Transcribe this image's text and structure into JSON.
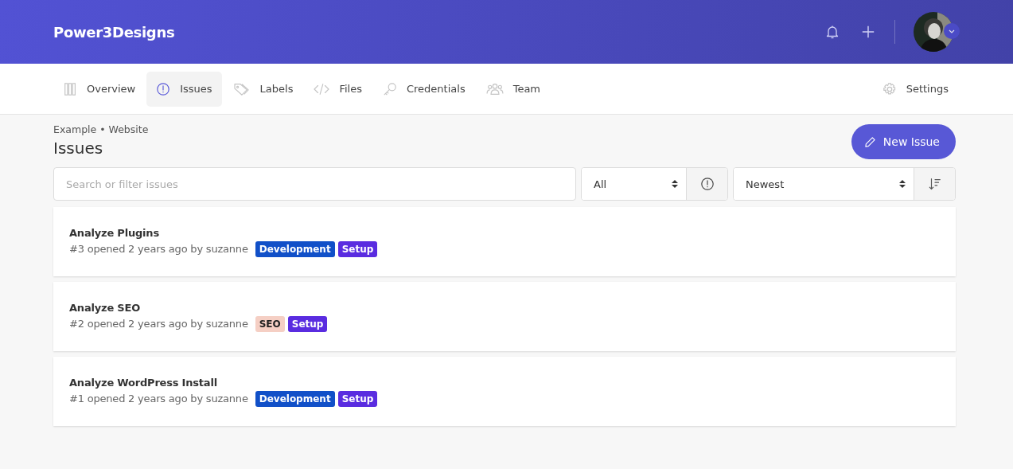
{
  "brand": "Power3Designs",
  "tabs": [
    {
      "label": "Overview",
      "kind": "overview",
      "selected": false
    },
    {
      "label": "Issues",
      "kind": "issues",
      "selected": true
    },
    {
      "label": "Labels",
      "kind": "labels",
      "selected": false
    },
    {
      "label": "Files",
      "kind": "files",
      "selected": false
    },
    {
      "label": "Credentials",
      "kind": "credentials",
      "selected": false
    },
    {
      "label": "Team",
      "kind": "team",
      "selected": false
    }
  ],
  "settings_tab": {
    "label": "Settings",
    "kind": "settings",
    "selected": false
  },
  "breadcrumb": "Example • Website",
  "page_title": "Issues",
  "new_button": "New Issue",
  "search": {
    "placeholder": "Search or filter issues"
  },
  "status_filter": "All",
  "sort": "Newest",
  "issues": [
    {
      "title": "Analyze Plugins",
      "meta": "#3 opened 2 years ago by suzanne",
      "labels": [
        {
          "text": "Development",
          "color": "#1150c8"
        },
        {
          "text": "Setup",
          "color": "#5a2ce0"
        }
      ]
    },
    {
      "title": "Analyze SEO",
      "meta": "#2 opened 2 years ago by suzanne",
      "labels": [
        {
          "text": "SEO",
          "color": "#f5cfc4"
        },
        {
          "text": "Setup",
          "color": "#5a2ce0"
        }
      ]
    },
    {
      "title": "Analyze WordPress Install",
      "meta": "#1 opened 2 years ago by suzanne",
      "labels": [
        {
          "text": "Development",
          "color": "#1150c8"
        },
        {
          "text": "Setup",
          "color": "#5a2ce0"
        }
      ]
    }
  ]
}
